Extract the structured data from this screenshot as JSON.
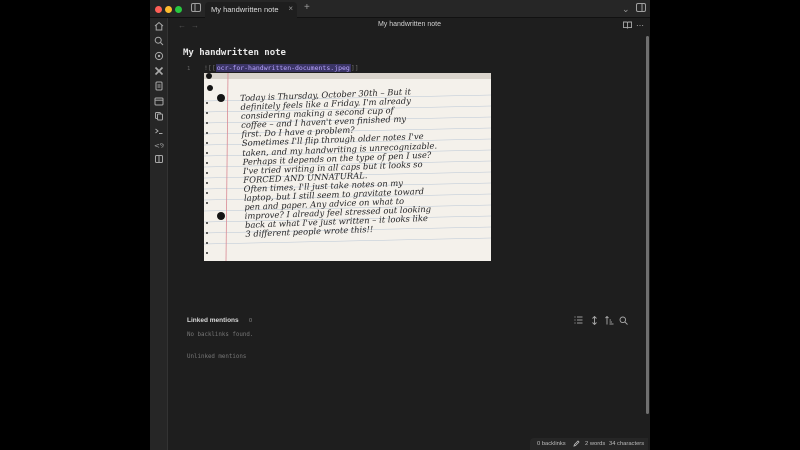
{
  "tab": {
    "title": "My handwritten note",
    "close": "×",
    "new": "+"
  },
  "titlebar": {
    "chevron": "⌄",
    "sidebar_toggle": "▯"
  },
  "navbar": {
    "back": "←",
    "forward": "→",
    "title": "My handwritten note",
    "reading_mode": "📖",
    "more": "⋯"
  },
  "ribbon": {
    "items": [
      "home-icon",
      "search-icon",
      "graph-icon",
      "plugin-icon",
      "files-icon",
      "calendar-icon",
      "copy-icon",
      "terminal-icon",
      "percent-icon",
      "book-icon"
    ]
  },
  "note": {
    "title": "My handwritten note",
    "line_number": "1",
    "embed_open": "![[",
    "embed_file": "ocr-for-handwritten-documents.jpeg",
    "embed_close": "]]",
    "image_lines": [
      "Today is Thursday, October 30th – But it",
      "definitely feels like a Friday. I'm already",
      "considering making a second cup of",
      "coffee – and I haven't even finished my",
      "first. Do I have a problem?",
      "Sometimes I'll flip through older notes I've",
      "taken, and my handwriting is unrecognizable.",
      "Perhaps it depends on the type of pen I use?",
      "I've tried writing in all caps but it looks so",
      "FORCED AND UNNATURAL.",
      "Often times, I'll just take notes on my",
      "laptop, but I still seem to gravitate toward",
      "pen and paper. Any advice on what to",
      "improve? I already feel stressed out looking",
      "back at what I've just written – it looks like",
      "3 different people wrote this!!"
    ]
  },
  "linked_mentions": {
    "title": "Linked mentions",
    "count": "0",
    "empty": "No backlinks found.",
    "unlinked": "Unlinked mentions"
  },
  "status": {
    "backlinks": "0 backlinks",
    "words": "2 words",
    "characters": "34 characters"
  }
}
